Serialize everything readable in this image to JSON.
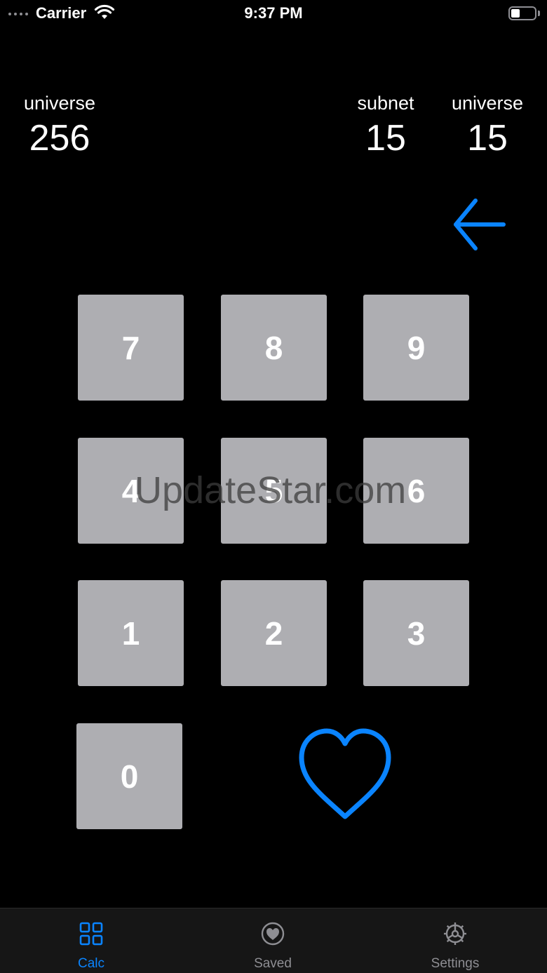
{
  "status_bar": {
    "carrier": "Carrier",
    "time": "9:37 PM",
    "wifi_icon": "wifi-icon",
    "battery_icon": "battery-icon",
    "battery_level": 0.3
  },
  "readouts": {
    "left": {
      "label": "universe",
      "value": "256"
    },
    "subnet": {
      "label": "subnet",
      "value": "15"
    },
    "universe": {
      "label": "universe",
      "value": "15"
    }
  },
  "keypad": {
    "keys": [
      "7",
      "8",
      "9",
      "4",
      "5",
      "6",
      "1",
      "2",
      "3",
      "0"
    ],
    "backspace_icon": "arrow-left-icon",
    "favorite_icon": "heart-icon"
  },
  "watermark": "UpdateStar.com",
  "tab_bar": {
    "tabs": [
      {
        "label": "Calc",
        "icon": "grid-icon",
        "active": true
      },
      {
        "label": "Saved",
        "icon": "heart-circle-icon",
        "active": false
      },
      {
        "label": "Settings",
        "icon": "gear-icon",
        "active": false
      }
    ]
  },
  "colors": {
    "accent": "#0a84ff",
    "key_background": "#aeaeb2",
    "background": "#000000",
    "tab_inactive": "#8e8e93"
  }
}
